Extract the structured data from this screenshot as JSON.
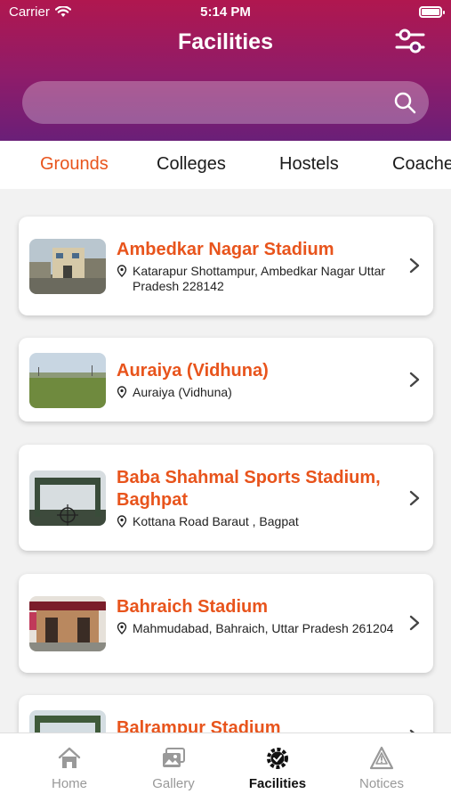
{
  "status_bar": {
    "carrier": "Carrier",
    "time": "5:14 PM"
  },
  "header": {
    "title": "Facilities"
  },
  "search": {
    "placeholder": ""
  },
  "tabs": [
    {
      "label": "Grounds",
      "active": true
    },
    {
      "label": "Colleges"
    },
    {
      "label": "Hostels"
    },
    {
      "label": "Coaches"
    }
  ],
  "facilities": [
    {
      "name": "Ambedkar Nagar Stadium",
      "address": "Katarapur Shottampur, Ambedkar Nagar Uttar Pradesh 228142"
    },
    {
      "name": "Auraiya (Vidhuna)",
      "address": "Auraiya (Vidhuna)"
    },
    {
      "name": "Baba Shahmal Sports Stadium, Baghpat",
      "address": "Kottana Road Baraut , Bagpat"
    },
    {
      "name": "Bahraich Stadium",
      "address": "Mahmudabad, Bahraich, Uttar Pradesh 261204"
    },
    {
      "name": "Balrampur Stadium",
      "address": ""
    }
  ],
  "bottom_nav": [
    {
      "label": "Home",
      "icon": "home-icon"
    },
    {
      "label": "Gallery",
      "icon": "gallery-icon"
    },
    {
      "label": "Facilities",
      "icon": "facilities-icon",
      "active": true
    },
    {
      "label": "Notices",
      "icon": "notices-icon"
    }
  ],
  "colors": {
    "accent": "#e8541c",
    "header_top": "#b0174f",
    "header_bottom": "#6a1f78"
  }
}
